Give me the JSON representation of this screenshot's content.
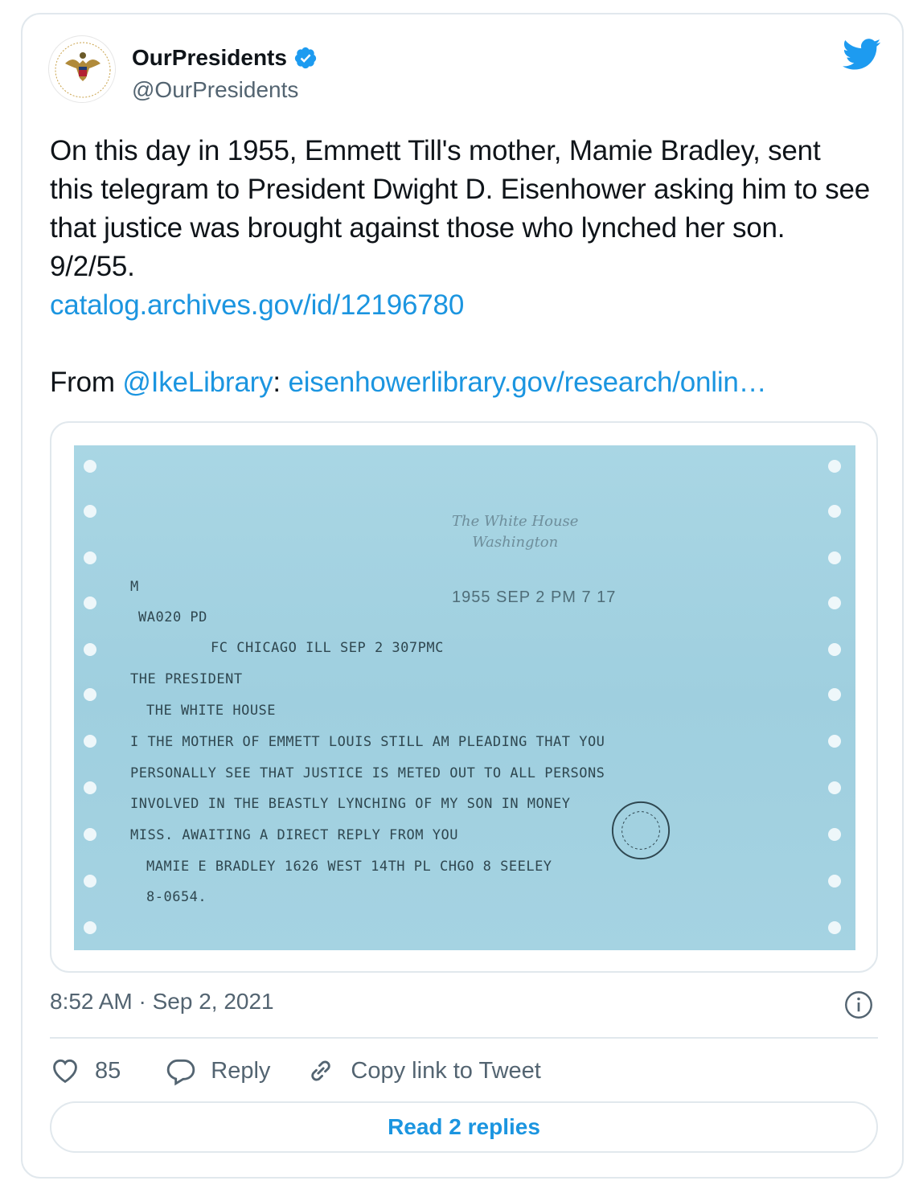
{
  "author": {
    "display_name": "OurPresidents",
    "handle": "@OurPresidents",
    "verified": true,
    "avatar_icon": "presidential-libraries-seal-icon"
  },
  "tweet": {
    "text_main": "On this day in 1955, Emmett Till's mother, Mamie Bradley, sent this telegram to President Dwight D. Eisenhower asking him to see that justice was brought against those who lynched her son. 9/2/55.",
    "link_catalog": "catalog.archives.gov/id/12196780",
    "from_prefix": "From ",
    "mention": "@IkeLibrary",
    "from_colon": ": ",
    "link_eisenhower": "eisenhowerlibrary.gov/research/onlin…"
  },
  "telegram": {
    "stamp_line1": "The White House",
    "stamp_line2": "Washington",
    "date_stamp": "1955 SEP 2  PM 7 17",
    "lines": [
      "M",
      "WA020 PD",
      "FC CHICAGO ILL SEP 2 307PMC",
      "THE PRESIDENT",
      "THE WHITE HOUSE",
      "I THE MOTHER OF EMMETT LOUIS STILL AM PLEADING THAT YOU",
      "PERSONALLY SEE THAT JUSTICE IS METED OUT TO ALL PERSONS",
      "INVOLVED IN THE BEASTLY LYNCHING OF MY SON IN MONEY",
      "MISS. AWAITING A DIRECT REPLY FROM YOU",
      "MAMIE E BRADLEY 1626 WEST 14TH PL CHGO 8 SEELEY",
      "8-0654."
    ]
  },
  "meta": {
    "timestamp": "8:52 AM · Sep 2, 2021"
  },
  "actions": {
    "like_count": "85",
    "reply_label": "Reply",
    "copy_link_label": "Copy link to Tweet"
  },
  "footer": {
    "read_replies_label": "Read 2 replies"
  },
  "colors": {
    "link": "#1b95e0",
    "twitter_blue": "#1d9bf0",
    "telegram_paper": "#a5d3e2",
    "secondary_text": "#536471"
  }
}
